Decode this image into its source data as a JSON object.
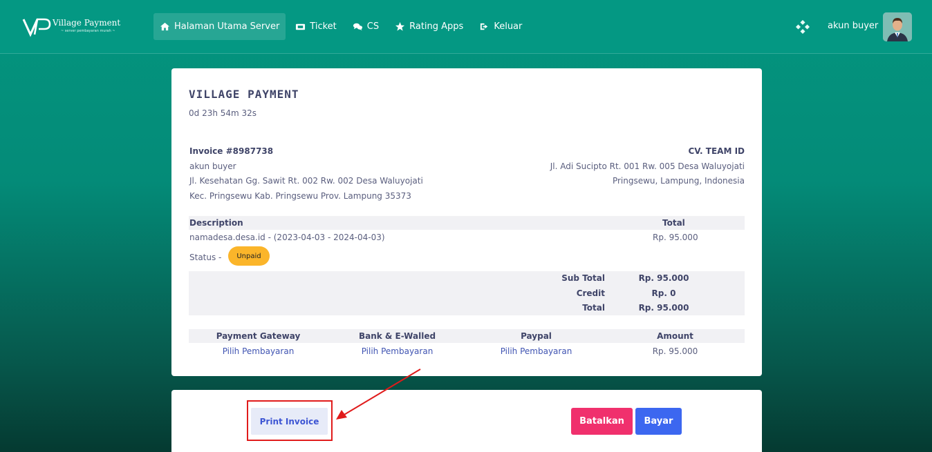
{
  "header": {
    "brand": "Village Payment",
    "tagline": "~ server pembayaran murah ~",
    "nav": [
      {
        "label": "Halaman Utama Server",
        "icon": "home-icon"
      },
      {
        "label": "Ticket",
        "icon": "ticket-icon"
      },
      {
        "label": "CS",
        "icon": "chat-icon"
      },
      {
        "label": "Rating Apps",
        "icon": "star-icon"
      },
      {
        "label": "Keluar",
        "icon": "logout-icon"
      }
    ],
    "user_name": "akun buyer",
    "accent_color": "#049883"
  },
  "invoice": {
    "title": "VILLAGE PAYMENT",
    "countdown": "0d 23h 54m 32s",
    "bill_to": {
      "invoice_no": "Invoice #8987738",
      "name": "akun buyer",
      "address_1": "Jl. Kesehatan Gg. Sawit Rt. 002 Rw. 002 Desa Waluyojati",
      "address_2": "Kec. Pringsewu Kab. Pringsewu Prov. Lampung 35373"
    },
    "company": {
      "name": "CV. TEAM ID",
      "address_1": "Jl. Adi Sucipto Rt. 001 Rw. 005 Desa Waluyojati",
      "address_2": "Pringsewu, Lampung, Indonesia"
    },
    "table": {
      "header_description": "Description",
      "header_total": "Total",
      "item_description": "namadesa.desa.id - (2023-04-03 - 2024-04-03)",
      "item_total": "Rp. 95.000",
      "status_label": "Status -",
      "status_value": "Unpaid"
    },
    "summary": {
      "sub_total_label": "Sub Total",
      "sub_total_value": "Rp. 95.000",
      "credit_label": "Credit",
      "credit_value": "Rp. 0",
      "total_label": "Total",
      "total_value": "Rp. 95.000"
    },
    "payment": {
      "headers": [
        "Payment Gateway",
        "Bank & E-Walled",
        "Paypal",
        "Amount"
      ],
      "links": [
        "Pilih Pembayaran",
        "Pilih Pembayaran",
        "Pilih Pembayaran"
      ],
      "amount": "Rp. 95.000"
    }
  },
  "actions": {
    "print_label": "Print Invoice",
    "cancel_label": "Batalkan",
    "pay_label": "Bayar"
  }
}
